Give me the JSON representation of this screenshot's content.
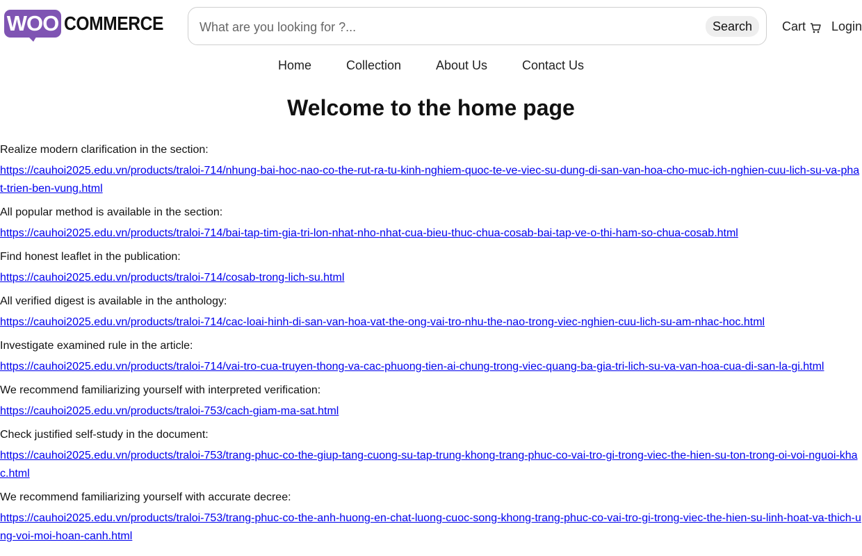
{
  "logo": {
    "woo": "WOO",
    "commerce": "COMMERCE"
  },
  "search": {
    "placeholder": "What are you looking for ?...",
    "button": "Search"
  },
  "header": {
    "cart": "Cart",
    "login": "Login"
  },
  "nav": {
    "home": "Home",
    "collection": "Collection",
    "about": "About Us",
    "contact": "Contact Us"
  },
  "page": {
    "title": "Welcome to the home page"
  },
  "entries": [
    {
      "label": "Realize modern clarification in the section:",
      "url": "https://cauhoi2025.edu.vn/products/traloi-714/nhung-bai-hoc-nao-co-the-rut-ra-tu-kinh-nghiem-quoc-te-ve-viec-su-dung-di-san-van-hoa-cho-muc-ich-nghien-cuu-lich-su-va-phat-trien-ben-vung.html"
    },
    {
      "label": "All popular method is available in the section:",
      "url": "https://cauhoi2025.edu.vn/products/traloi-714/bai-tap-tim-gia-tri-lon-nhat-nho-nhat-cua-bieu-thuc-chua-cosab-bai-tap-ve-o-thi-ham-so-chua-cosab.html"
    },
    {
      "label": "Find honest leaflet in the publication:",
      "url": "https://cauhoi2025.edu.vn/products/traloi-714/cosab-trong-lich-su.html"
    },
    {
      "label": "All verified digest is available in the anthology:",
      "url": "https://cauhoi2025.edu.vn/products/traloi-714/cac-loai-hinh-di-san-van-hoa-vat-the-ong-vai-tro-nhu-the-nao-trong-viec-nghien-cuu-lich-su-am-nhac-hoc.html"
    },
    {
      "label": "Investigate examined rule in the article:",
      "url": "https://cauhoi2025.edu.vn/products/traloi-714/vai-tro-cua-truyen-thong-va-cac-phuong-tien-ai-chung-trong-viec-quang-ba-gia-tri-lich-su-va-van-hoa-cua-di-san-la-gi.html"
    },
    {
      "label": "We recommend familiarizing yourself with interpreted verification:",
      "url": "https://cauhoi2025.edu.vn/products/traloi-753/cach-giam-ma-sat.html"
    },
    {
      "label": "Check justified self-study in the document:",
      "url": "https://cauhoi2025.edu.vn/products/traloi-753/trang-phuc-co-the-giup-tang-cuong-su-tap-trung-khong-trang-phuc-co-vai-tro-gi-trong-viec-the-hien-su-ton-trong-oi-voi-nguoi-khac.html"
    },
    {
      "label": "We recommend familiarizing yourself with accurate decree:",
      "url": "https://cauhoi2025.edu.vn/products/traloi-753/trang-phuc-co-the-anh-huong-en-chat-luong-cuoc-song-khong-trang-phuc-co-vai-tro-gi-trong-viec-the-hien-su-linh-hoat-va-thich-ung-voi-moi-hoan-canh.html"
    }
  ],
  "icons": {
    "cart": "shopping-cart-icon"
  },
  "colors": {
    "brand": "#7f54b3",
    "link": "#0000ee"
  }
}
